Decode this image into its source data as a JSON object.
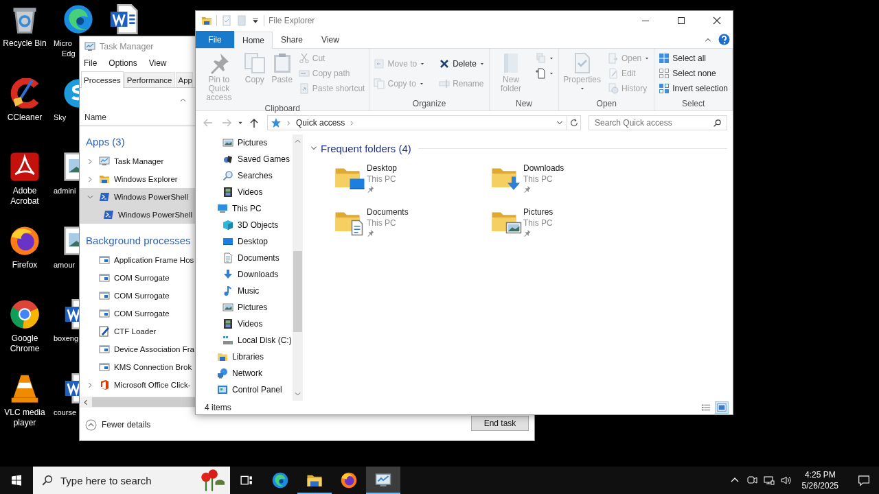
{
  "desktop": {
    "icons": [
      {
        "label": "Recycle Bin"
      },
      {
        "label": "CCleaner"
      },
      {
        "label": "Adobe Acrobat"
      },
      {
        "label": "Firefox"
      },
      {
        "label": "Google Chrome"
      },
      {
        "label": "VLC media player"
      }
    ],
    "partly_covered_icons": [
      {
        "lines": [
          "Micro",
          "Edg"
        ]
      },
      {
        "lines": [
          "Sky"
        ]
      },
      {
        "lines": [
          "admini"
        ]
      },
      {
        "lines": [
          "amour"
        ]
      },
      {
        "lines": [
          "boxeng"
        ]
      },
      {
        "lines": [
          "course"
        ]
      }
    ]
  },
  "task_manager": {
    "title": "Task Manager",
    "menu": [
      "File",
      "Options",
      "View"
    ],
    "tabs": [
      {
        "label": "Processes",
        "selected": true
      },
      {
        "label": "Performance",
        "selected": false
      },
      {
        "label": "App",
        "selected": false
      }
    ],
    "column": "Name",
    "groups": [
      {
        "title": "Apps (3)",
        "rows": [
          {
            "name": "Task Manager",
            "expanded": false,
            "selected": false
          },
          {
            "name": "Windows Explorer",
            "expanded": false,
            "selected": false
          },
          {
            "name": "Windows PowerShell",
            "expanded": true,
            "selected": true,
            "children": [
              {
                "name": "Windows PowerShell",
                "selected": true
              }
            ]
          }
        ]
      },
      {
        "title": "Background processes",
        "rows": [
          {
            "name": "Application Frame Hos",
            "selected": false
          },
          {
            "name": "COM Surrogate",
            "selected": false
          },
          {
            "name": "COM Surrogate",
            "selected": false
          },
          {
            "name": "COM Surrogate",
            "selected": false
          },
          {
            "name": "CTF Loader",
            "selected": false
          },
          {
            "name": "Device Association Fra",
            "selected": false
          },
          {
            "name": "KMS Connection Brok",
            "selected": false
          },
          {
            "name": "Microsoft Office Click-",
            "expanded": false,
            "selected": false
          }
        ]
      }
    ],
    "fewer_details": "Fewer details",
    "end_task": "End task"
  },
  "file_explorer": {
    "title": "File Explorer",
    "ribbon": {
      "tabs": [
        {
          "label": "File",
          "kind": "menu",
          "selected": false
        },
        {
          "label": "Home",
          "kind": "tab",
          "selected": true
        },
        {
          "label": "Share",
          "kind": "tab",
          "selected": false
        },
        {
          "label": "View",
          "kind": "tab",
          "selected": false
        }
      ],
      "groups": [
        {
          "label": "Clipboard",
          "columns": [
            [
              {
                "label": "Pin to Quick access",
                "disabled": true
              }
            ],
            [
              {
                "label": "Copy",
                "disabled": true
              }
            ],
            [
              {
                "label": "Paste",
                "disabled": true
              }
            ],
            [
              {
                "label": "Cut",
                "disabled": true
              },
              {
                "label": "Copy path",
                "disabled": true
              },
              {
                "label": "Paste shortcut",
                "disabled": true
              }
            ]
          ]
        },
        {
          "label": "Organize",
          "columns": [
            [
              {
                "label": "Move to",
                "disabled": true,
                "dropdown": true
              },
              {
                "label": "Copy to",
                "disabled": true,
                "dropdown": true
              }
            ],
            [
              {
                "label": "Delete",
                "disabled": false,
                "dropdown": true
              },
              {
                "label": "Rename",
                "disabled": true
              }
            ]
          ]
        },
        {
          "label": "New",
          "columns": [
            [
              {
                "label": "New folder",
                "disabled": true
              }
            ],
            [
              {
                "disabled": true,
                "dropdown": true
              },
              {
                "disabled": false,
                "dropdown": true
              }
            ]
          ]
        },
        {
          "label": "Open",
          "columns": [
            [
              {
                "label": "Properties",
                "disabled": true,
                "dropdown": true
              }
            ],
            [
              {
                "label": "Open",
                "disabled": true,
                "dropdown": true
              },
              {
                "label": "Edit",
                "disabled": true
              },
              {
                "label": "History",
                "disabled": true
              }
            ]
          ]
        },
        {
          "label": "Select",
          "columns": [
            [
              {
                "label": "Select all",
                "disabled": false
              },
              {
                "label": "Select none",
                "disabled": false
              },
              {
                "label": "Invert selection",
                "disabled": false
              }
            ]
          ]
        }
      ]
    },
    "address": {
      "path": [
        "Quick access"
      ],
      "search_placeholder": "Search Quick access"
    },
    "nav": [
      {
        "children": [
          {
            "label": "Pictures"
          },
          {
            "label": "Saved Games"
          },
          {
            "label": "Searches"
          },
          {
            "label": "Videos"
          }
        ]
      },
      {
        "label": "This PC",
        "children": [
          {
            "label": "3D Objects"
          },
          {
            "label": "Desktop"
          },
          {
            "label": "Documents"
          },
          {
            "label": "Downloads"
          },
          {
            "label": "Music"
          },
          {
            "label": "Pictures"
          },
          {
            "label": "Videos"
          },
          {
            "label": "Local Disk (C:)"
          }
        ]
      },
      {
        "label": "Libraries"
      },
      {
        "label": "Network"
      },
      {
        "label": "Control Panel"
      }
    ],
    "section": {
      "title": "Frequent folders (4)",
      "expanded": true,
      "folders": [
        {
          "name": "Desktop",
          "location": "This PC",
          "pinned": true
        },
        {
          "name": "Downloads",
          "location": "This PC",
          "pinned": true
        },
        {
          "name": "Documents",
          "location": "This PC",
          "pinned": true
        },
        {
          "name": "Pictures",
          "location": "This PC",
          "pinned": true
        }
      ]
    },
    "status": "4 items",
    "views": [
      {
        "kind": "details",
        "selected": false
      },
      {
        "kind": "large-icons",
        "selected": true
      }
    ]
  },
  "taskbar": {
    "search_placeholder": "Type here to search",
    "apps": [
      {
        "open": false,
        "selected": false
      },
      {
        "open": true,
        "selected": false
      },
      {
        "open": false,
        "selected": false
      },
      {
        "open": true,
        "selected": true
      }
    ],
    "time": "4:25 PM",
    "date": "5/26/2025"
  }
}
